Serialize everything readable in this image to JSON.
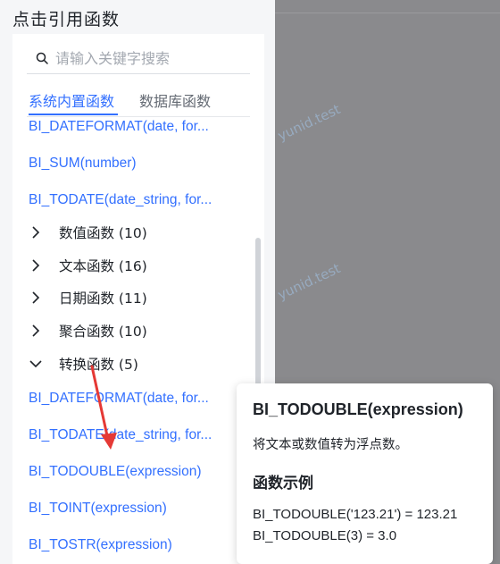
{
  "panel": {
    "title": "点击引用函数",
    "search": {
      "placeholder": "请输入关键字搜索",
      "value": ""
    },
    "tabs": [
      {
        "label": "系统内置函数",
        "active": true
      },
      {
        "label": "数据库函数",
        "active": false
      }
    ],
    "top_functions": [
      "BI_DATEFORMAT(date, for...",
      "BI_SUM(number)",
      "BI_TODATE(date_string, for..."
    ],
    "categories": [
      {
        "label": "数值函数 (10)",
        "expanded": false
      },
      {
        "label": "文本函数 (16)",
        "expanded": false
      },
      {
        "label": "日期函数 (11)",
        "expanded": false
      },
      {
        "label": "聚合函数 (10)",
        "expanded": false
      },
      {
        "label": "转换函数 (5)",
        "expanded": true
      }
    ],
    "conversion_functions": [
      "BI_DATEFORMAT(date, for...",
      "BI_TODATE(date_string, for...",
      "BI_TODOUBLE(expression)",
      "BI_TOINT(expression)",
      "BI_TOSTR(expression)"
    ]
  },
  "popover": {
    "title": "BI_TODOUBLE(expression)",
    "description": "将文本或数值转为浮点数。",
    "example_heading": "函数示例",
    "examples": [
      "BI_TODOUBLE('123.21') = 123.21",
      "BI_TODOUBLE(3) = 3.0"
    ]
  },
  "watermarks": [
    "yunid.test",
    "yunid.test"
  ],
  "colors": {
    "accent": "#3370ff",
    "overlay": "#8a8a8d",
    "arrow": "#e53935"
  }
}
